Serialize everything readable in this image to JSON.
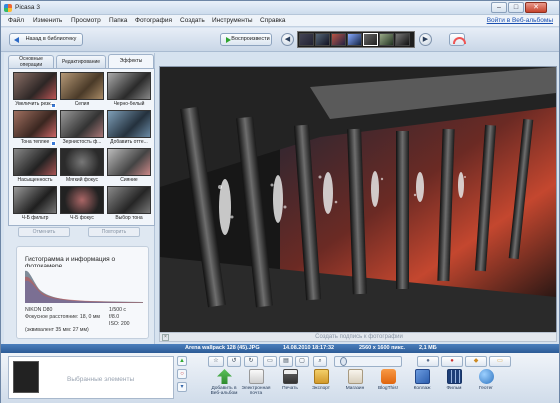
{
  "window": {
    "title": "Picasa 3",
    "minimize": "–",
    "maximize": "□",
    "close": "✕"
  },
  "menu": {
    "items": [
      "Файл",
      "Изменить",
      "Просмотр",
      "Папка",
      "Фотография",
      "Создать",
      "Инструменты",
      "Справка"
    ],
    "web_signin": "Войти в Веб-альбомы"
  },
  "toolbar": {
    "back_label": "Назад в библиотеку",
    "slideshow_label": "Воспроизвести",
    "prev_icon": "arrow-left-icon",
    "next_icon": "arrow-right-icon"
  },
  "tabs": [
    {
      "label": "Основные операции"
    },
    {
      "label": "Редактирование"
    },
    {
      "label": "Эффекты"
    }
  ],
  "effects": [
    {
      "label": "Увеличить резк..."
    },
    {
      "label": "Сепия"
    },
    {
      "label": "Черно-белый"
    },
    {
      "label": "Тона теплее"
    },
    {
      "label": "Зернистость ф..."
    },
    {
      "label": "Добавить отте..."
    },
    {
      "label": "Насыщенность"
    },
    {
      "label": "Мягкий фокус"
    },
    {
      "label": "Сияние"
    },
    {
      "label": "Ч-Б фильтр"
    },
    {
      "label": "Ч-Б фокус"
    },
    {
      "label": "Выбор тона"
    }
  ],
  "panel_buttons": {
    "undo": "Отменить",
    "redo": "Повторить"
  },
  "histogram": {
    "title": "Гистограмма и информация о фотокамере",
    "camera": "NIKON D80",
    "focus_distance": "Фокусное расстояние: 18, 0 мм",
    "equivalent": "(эквивалент 35 мм: 27 мм)",
    "shutter": "1/500 с",
    "aperture": "f/8.0",
    "iso": "ISO: 200"
  },
  "caption": {
    "placeholder": "Создать подпись к фотографии"
  },
  "status": {
    "filename": "Arena wallpack 128 (45).JPG",
    "date": "14.08.2010 18:17:32",
    "dimensions": "2560 x 1600 пикс.",
    "size": "2,1 МБ"
  },
  "tray": {
    "label": "Выбранные элементы"
  },
  "actions": [
    {
      "label": "Добавить в Веб-альбом",
      "icon": "upload-icon",
      "color": "#3aa13a"
    },
    {
      "label": "Электронная почта",
      "icon": "email-icon",
      "color": "#d9d9d9"
    },
    {
      "label": "Печать",
      "icon": "printer-icon",
      "color": "#555555"
    },
    {
      "label": "Экспорт",
      "icon": "folder-icon",
      "color": "#e2b34a"
    },
    {
      "label": "Магазин",
      "icon": "shop-icon",
      "color": "#e7e0d2"
    },
    {
      "label": "BlogThis!",
      "icon": "blogger-icon",
      "color": "#f07a1a"
    },
    {
      "label": "Коллаж",
      "icon": "collage-icon",
      "color": "#3d6fc4"
    },
    {
      "label": "Фильм",
      "icon": "film-icon",
      "color": "#2c4f8c"
    },
    {
      "label": "Геотег",
      "icon": "geotag-icon",
      "color": "#3c8fd6"
    }
  ]
}
